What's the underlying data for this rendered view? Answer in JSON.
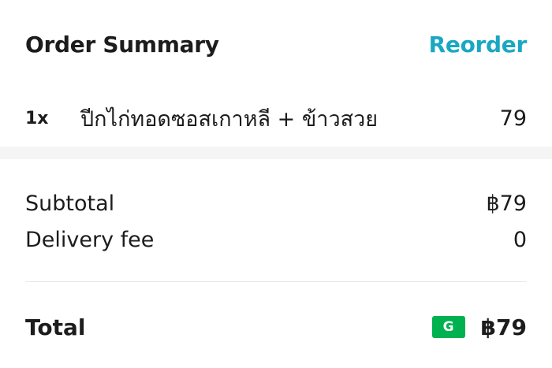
{
  "header": {
    "title": "Order Summary",
    "reorder_label": "Reorder"
  },
  "items": [
    {
      "quantity": "1x",
      "name": "ปีกไก่ทอดซอสเกาหลี + ข้าวสวย",
      "price": "79"
    }
  ],
  "summary": {
    "subtotal_label": "Subtotal",
    "subtotal_value": "฿79",
    "delivery_label": "Delivery fee",
    "delivery_value": "0"
  },
  "total": {
    "label": "Total",
    "payment_icon": "grabpay-icon",
    "payment_badge_text": "G",
    "value": "฿79"
  },
  "colors": {
    "accent": "#1aa7c2",
    "payment_green": "#00b14f",
    "text": "#1c1c1c",
    "section_gap": "#f5f5f5"
  }
}
